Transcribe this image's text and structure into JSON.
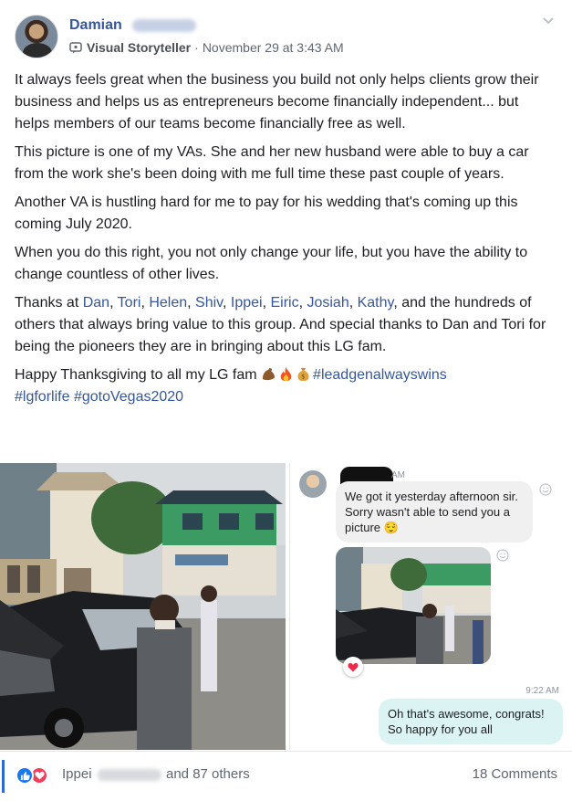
{
  "post": {
    "author_name": "Damian",
    "author_role": "Visual Storyteller",
    "separator": "·",
    "timestamp": "November 29 at 3:43 AM",
    "paragraphs": {
      "p1": "It always feels great when the business you build not only helps clients grow their business and helps us as entrepreneurs become financially independent... but helps members of our teams become financially free as well.",
      "p2": "This picture is one of my VAs. She and her new husband were able to buy a car from the work she's been doing with me full time these past couple of years.",
      "p3": "Another VA is hustling hard for me to pay for his wedding that's coming up this coming July 2020.",
      "p4": "When you do this right, you not only change your life, but you have the ability to change countless of other lives."
    },
    "thanks": {
      "prefix": "Thanks at ",
      "names": [
        "Dan",
        "Tori",
        "Helen",
        "Shiv",
        "Ippei",
        "Eiric",
        "Josiah",
        "Kathy"
      ],
      "comma": ", ",
      "suffix": ", and the hundreds of others that always bring value to this group. And special thanks to Dan and Tori for being the pioneers they are in bringing about this LG fam."
    },
    "closing": {
      "text": "Happy Thanksgiving to all my LG fam ",
      "hashtags": [
        "#leadgenalwayswins",
        "#lgforlife",
        "#gotoVegas2020"
      ]
    },
    "icons": {
      "badge": "visual-storyteller-badge-icon",
      "menu": "chevron-down-icon",
      "emojis": [
        "flexed-bicep-emoji",
        "fire-emoji",
        "money-bag-emoji"
      ]
    }
  },
  "chat": {
    "time_top": "AM",
    "incoming_message": "We got it yesterday afternoon sir. Sorry wasn't able to send you a picture 😌",
    "time_bottom": "9:22 AM",
    "outgoing_message": "Oh that's awesome, congrats! So happy for you all"
  },
  "footer": {
    "reactor_name": "Ippei",
    "others_text": "and 87 others",
    "comments_text": "18 Comments",
    "reaction_icons": [
      "like-icon",
      "love-icon"
    ]
  },
  "colors": {
    "link": "#365899",
    "text": "#1c1e21",
    "meta": "#606770",
    "like": "#1877f2",
    "love": "#f33e58"
  }
}
